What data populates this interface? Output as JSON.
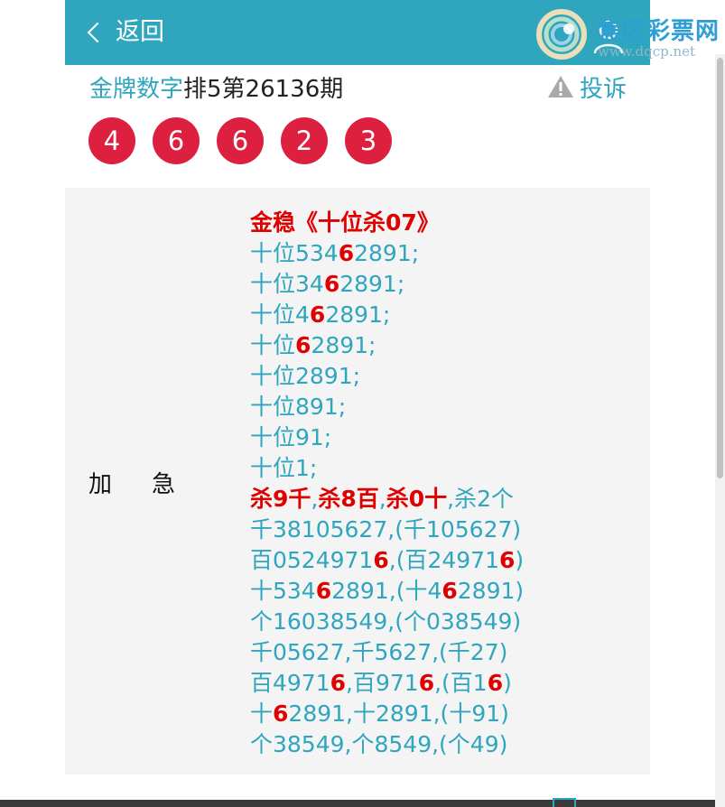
{
  "header": {
    "back_label": "返回"
  },
  "watermark": {
    "title": "焦区彩票网",
    "url": "www.dqcp.net"
  },
  "title_bar": {
    "link": "金牌数字",
    "rest": "排5第26136期",
    "complain": "投诉"
  },
  "balls": [
    "4",
    "6",
    "6",
    "2",
    "3"
  ],
  "panel": {
    "label": "加急",
    "lines": [
      [
        {
          "t": "金稳《十位杀07》",
          "r": true
        }
      ],
      [
        {
          "t": "十位534"
        },
        {
          "t": "6",
          "r": true
        },
        {
          "t": "2891;"
        }
      ],
      [
        {
          "t": "十位34"
        },
        {
          "t": "6",
          "r": true
        },
        {
          "t": "2891;"
        }
      ],
      [
        {
          "t": "十位4"
        },
        {
          "t": "6",
          "r": true
        },
        {
          "t": "2891;"
        }
      ],
      [
        {
          "t": "十位"
        },
        {
          "t": "6",
          "r": true
        },
        {
          "t": "2891;"
        }
      ],
      [
        {
          "t": "十位2891;"
        }
      ],
      [
        {
          "t": "十位891;"
        }
      ],
      [
        {
          "t": "十位91;"
        }
      ],
      [
        {
          "t": "十位1;"
        }
      ],
      [
        {
          "t": "杀9千",
          "r": true
        },
        {
          "t": ","
        },
        {
          "t": "杀8百",
          "r": true
        },
        {
          "t": ","
        },
        {
          "t": "杀0十",
          "r": true
        },
        {
          "t": ",杀2个"
        }
      ],
      [
        {
          "t": "千38105627,(千105627)"
        }
      ],
      [
        {
          "t": "百0524971"
        },
        {
          "t": "6",
          "r": true
        },
        {
          "t": ",(百24971"
        },
        {
          "t": "6",
          "r": true
        },
        {
          "t": ")"
        }
      ],
      [
        {
          "t": "十534"
        },
        {
          "t": "6",
          "r": true
        },
        {
          "t": "2891,(十4"
        },
        {
          "t": "6",
          "r": true
        },
        {
          "t": "2891)"
        }
      ],
      [
        {
          "t": "个16038549,(个038549)"
        }
      ],
      [
        {
          "t": "千05627,千5627,(千27)"
        }
      ],
      [
        {
          "t": "百4971"
        },
        {
          "t": "6",
          "r": true
        },
        {
          "t": ",百971"
        },
        {
          "t": "6",
          "r": true
        },
        {
          "t": ",(百1"
        },
        {
          "t": "6",
          "r": true
        },
        {
          "t": ")"
        }
      ],
      [
        {
          "t": "十"
        },
        {
          "t": "6",
          "r": true
        },
        {
          "t": "2891,十2891,(十91)"
        }
      ],
      [
        {
          "t": "个38549,个8549,(个49)"
        }
      ]
    ]
  },
  "colors": {
    "accent": "#2fa6be",
    "ball": "#dd2040",
    "highlight": "#e00000"
  }
}
